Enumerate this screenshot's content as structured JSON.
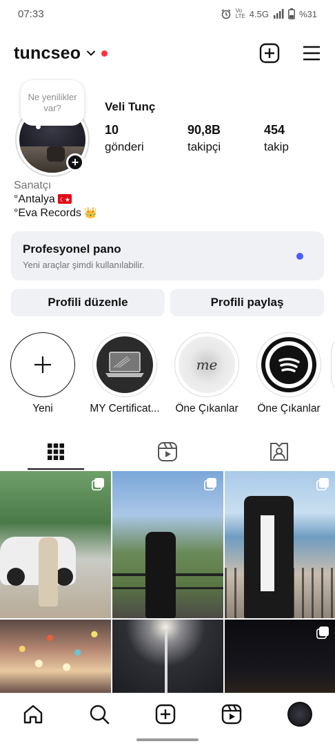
{
  "status": {
    "time": "07:33",
    "network": "4.5G",
    "volte": "Vo LTE",
    "battery": "%31"
  },
  "header": {
    "username": "tuncseo"
  },
  "profile": {
    "note": "Ne yenilikler var?",
    "full_name": "Veli Tunç",
    "stats": [
      {
        "value": "10",
        "label": "gönderi"
      },
      {
        "value": "90,8B",
        "label": "takipçi"
      },
      {
        "value": "454",
        "label": "takip"
      }
    ],
    "category": "Sanatçı",
    "bio_line1": "°Antalya",
    "bio_line2": "°Eva Records"
  },
  "pro_dashboard": {
    "title": "Profesyonel pano",
    "subtitle": "Yeni araçlar şimdi kullanılabilir."
  },
  "buttons": {
    "edit": "Profili düzenle",
    "share": "Profili paylaş"
  },
  "highlights": [
    {
      "label": "Yeni"
    },
    {
      "label": "MY Certificat..."
    },
    {
      "label": "Öne Çıkanlar",
      "text": "me"
    },
    {
      "label": "Öne Çıkanlar"
    }
  ],
  "colors": {
    "notification_dot": "#ff3040",
    "pro_dot": "#4a5df9",
    "button_bg": "#eff1f4"
  }
}
